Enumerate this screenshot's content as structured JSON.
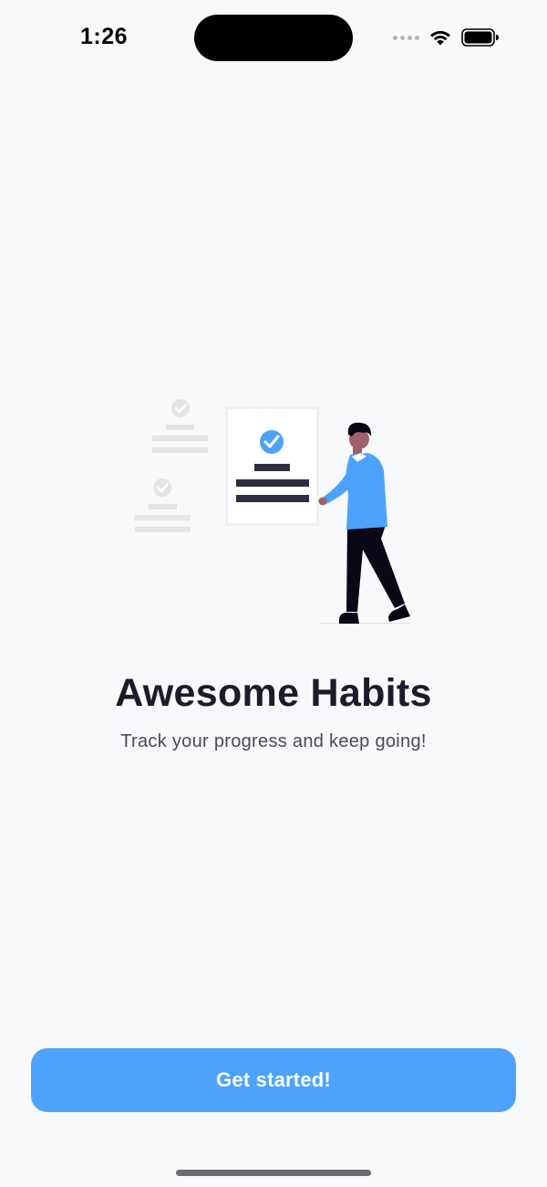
{
  "status_bar": {
    "time": "1:26"
  },
  "onboarding": {
    "title": "Awesome Habits",
    "subtitle": "Track your progress and keep going!",
    "cta_label": "Get started!"
  },
  "icons": {
    "wifi": "wifi-icon",
    "battery": "battery-icon",
    "cellular": "cellular-signal-icon",
    "check": "check-circle-icon"
  },
  "colors": {
    "accent": "#4da3fb",
    "background": "#f8f9fb",
    "title": "#1b1b29",
    "subtitle": "#4a4a55",
    "navy": "#2f2e41"
  }
}
